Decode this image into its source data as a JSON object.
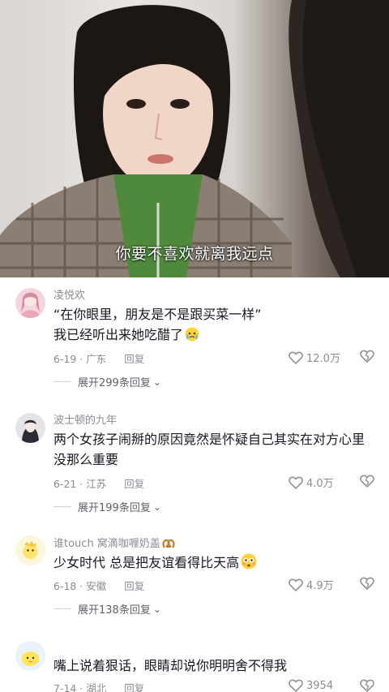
{
  "video": {
    "subtitle": "你要不喜欢就离我远点"
  },
  "comments": [
    {
      "author": "凌悦欢",
      "lines": [
        "“在你眼里，朋友是不是跟买菜一样”",
        "我已经听出来她吃醋了"
      ],
      "emoji": "crying-face-emoji",
      "date_location": "6-19 · 广东",
      "reply_label": "回复",
      "likes": "12.0万",
      "expand_label": "展开299条回复"
    },
    {
      "author": "波士顿的九年",
      "lines": [
        "两个女孩子闹掰的原因竟然是怀疑自己其实在对方心里",
        "没那么重要"
      ],
      "date_location": "6-21 · 江苏",
      "reply_label": "回复",
      "likes": "4.0万",
      "expand_label": "展开199条回复"
    },
    {
      "author": "谁touch 窝滴咖喱奶盖",
      "author_badge": "pretzel-emoji",
      "lines": [
        "少女时代 总是把友谊看得比天高"
      ],
      "emoji": "flushed-face-emoji",
      "date_location": "6-18 · 安徽",
      "reply_label": "回复",
      "likes": "4.9万",
      "expand_label": "展开138条回复"
    },
    {
      "author": "",
      "lines": [
        "嘴上说着狠话，眼睛却说你明明舍不得我"
      ],
      "date_location": "7-14 · 湖北",
      "reply_label": "回复",
      "likes": "3954"
    }
  ],
  "colors": {
    "text": "#161823",
    "secondary": "#8a8b91",
    "subtitle": "#ffffff"
  }
}
